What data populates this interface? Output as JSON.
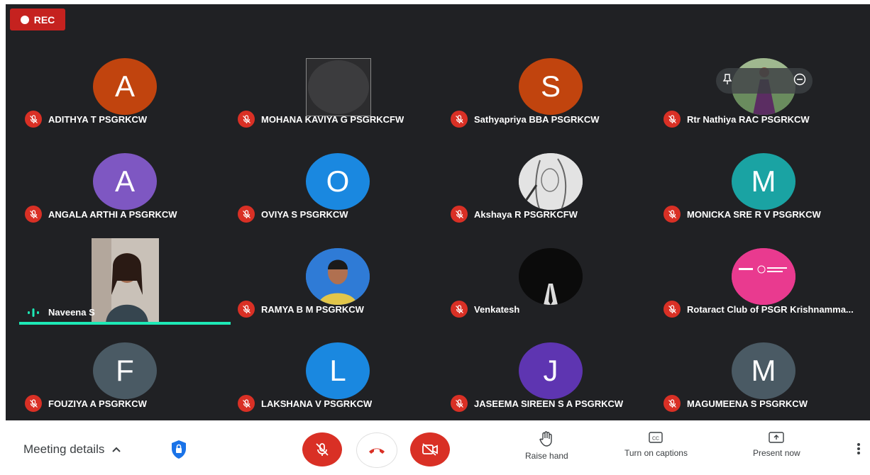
{
  "recording": {
    "label": "REC"
  },
  "participants": [
    {
      "name": "ADITHYA T PSGRKCW",
      "initial": "A",
      "color": "#c1440e",
      "muted": true
    },
    {
      "name": "MOHANA KAVIYA G PSGRKCFW",
      "initial": "",
      "color": "",
      "muted": true,
      "avatar": "broken-image"
    },
    {
      "name": "Sathyapriya BBA PSGRKCW",
      "initial": "S",
      "color": "#c1440e",
      "muted": true
    },
    {
      "name": "Rtr Nathiya RAC PSGRKCW",
      "initial": "",
      "color": "#6a8c5e",
      "muted": true,
      "avatar": "photo"
    },
    {
      "name": "ANGALA ARTHI A PSGRKCW",
      "initial": "A",
      "color": "#7e57c2",
      "muted": true
    },
    {
      "name": "OVIYA S PSGRKCW",
      "initial": "O",
      "color": "#1a88e0",
      "muted": true
    },
    {
      "name": "Akshaya R PSGRKCFW",
      "initial": "",
      "color": "#d8d8d8",
      "muted": true,
      "avatar": "sketch"
    },
    {
      "name": "MONICKA SRE R V PSGRKCW",
      "initial": "M",
      "color": "#1aa3a3",
      "muted": true
    },
    {
      "name": "Naveena S",
      "initial": "",
      "color": "",
      "muted": false,
      "speaking": true,
      "avatar": "video"
    },
    {
      "name": "RAMYA B M PSGRKCW",
      "initial": "",
      "color": "#2f7bd6",
      "muted": true,
      "avatar": "photo"
    },
    {
      "name": "Venkatesh",
      "initial": "",
      "color": "#111111",
      "muted": true,
      "avatar": "photo"
    },
    {
      "name": "Rotaract Club of PSGR Krishnamma...",
      "initial": "",
      "color": "#e93a8f",
      "muted": true,
      "avatar": "logo"
    },
    {
      "name": "FOUZIYA A PSGRKCW",
      "initial": "F",
      "color": "#4a5a64",
      "muted": true
    },
    {
      "name": "LAKSHANA V PSGRKCW",
      "initial": "L",
      "color": "#1a88e0",
      "muted": true
    },
    {
      "name": "JASEEMA SIREEN S A PSGRKCW",
      "initial": "J",
      "color": "#5e35b1",
      "muted": true
    },
    {
      "name": "MAGUMEENA S PSGRKCW",
      "initial": "M",
      "color": "#4a5a64",
      "muted": true
    }
  ],
  "bottom_bar": {
    "meeting_details": "Meeting details",
    "raise_hand": "Raise hand",
    "captions": "Turn on captions",
    "present": "Present now"
  },
  "colors": {
    "accent_red": "#d93025",
    "speaking": "#1de9b6",
    "stage": "#202124"
  }
}
